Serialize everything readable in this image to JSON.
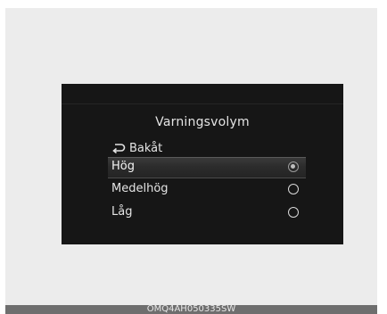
{
  "screen": {
    "title": "Varningsvolym",
    "back_label": "Bakåt",
    "options": [
      {
        "label": "Hög",
        "selected": true
      },
      {
        "label": "Medelhög",
        "selected": false
      },
      {
        "label": "Låg",
        "selected": false
      }
    ]
  },
  "caption": "OMQ4AH050335SW",
  "icons": {
    "back": "back-arrow-icon",
    "radio_on": "radio-selected-icon",
    "radio_off": "radio-unselected-icon"
  }
}
